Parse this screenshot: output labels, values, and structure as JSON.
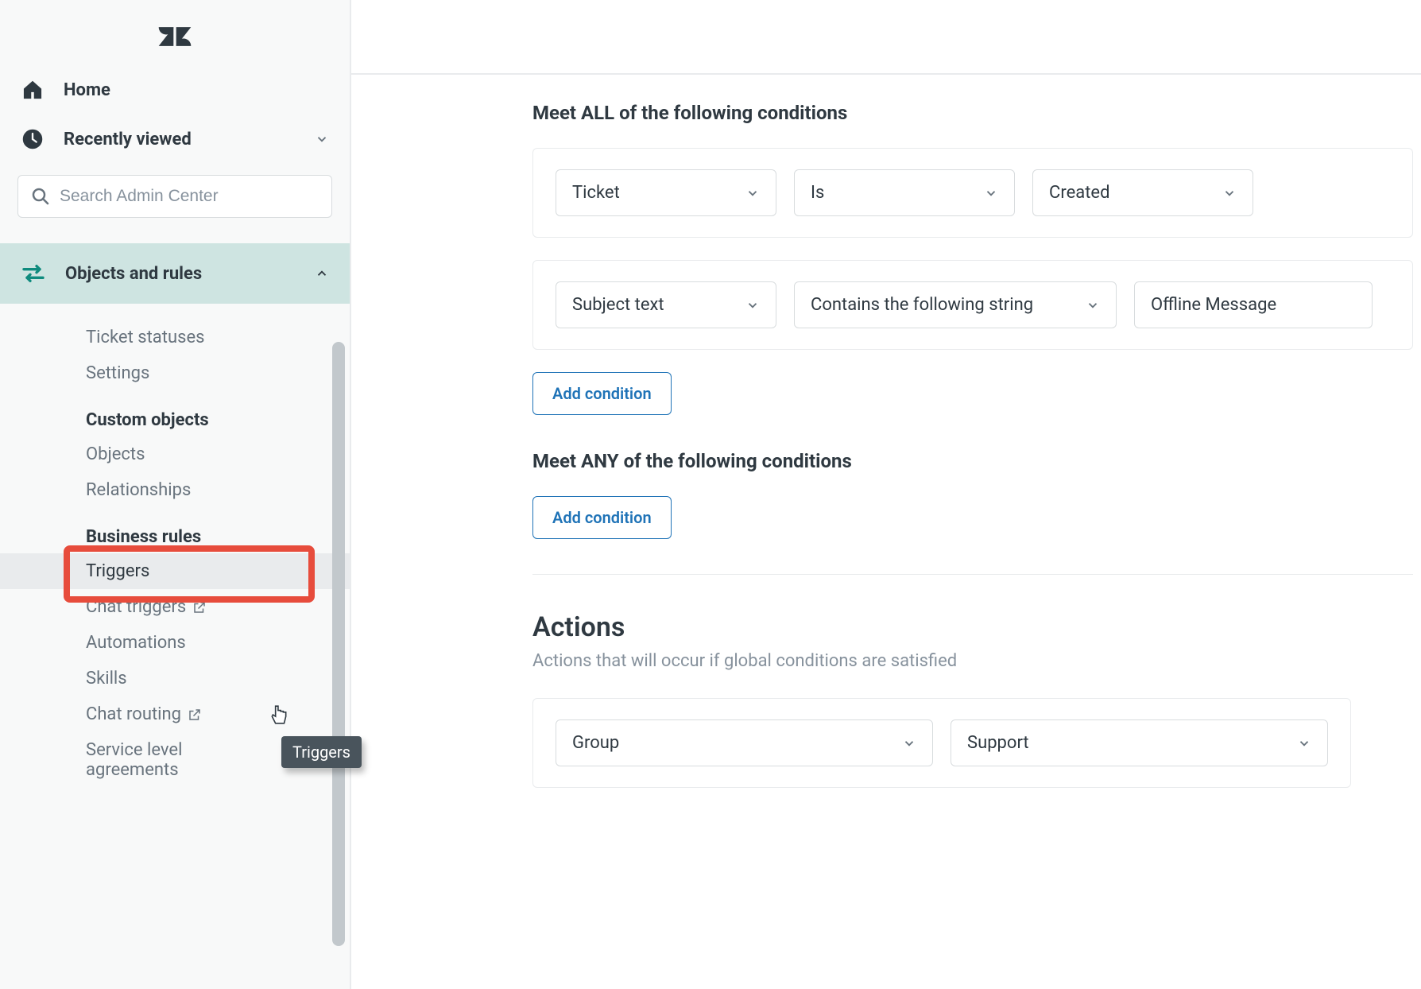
{
  "sidebar": {
    "home": "Home",
    "recently_viewed": "Recently viewed",
    "search_placeholder": "Search Admin Center",
    "section_label": "Objects and rules",
    "items": {
      "ticket_statuses": "Ticket statuses",
      "settings": "Settings",
      "custom_objects_header": "Custom objects",
      "objects": "Objects",
      "relationships": "Relationships",
      "business_rules_header": "Business rules",
      "triggers": "Triggers",
      "chat_triggers": "Chat triggers",
      "automations": "Automations",
      "skills": "Skills",
      "chat_routing": "Chat routing",
      "sla": "Service level agreements"
    },
    "tooltip": "Triggers"
  },
  "main": {
    "all_title": "Meet ALL of the following conditions",
    "any_title": "Meet ANY of the following conditions",
    "add_condition": "Add condition",
    "cond_all": [
      {
        "field": "Ticket",
        "op": "Is",
        "value": "Created"
      },
      {
        "field": "Subject text",
        "op": "Contains the following string",
        "text": "Offline Message"
      }
    ],
    "actions_heading": "Actions",
    "actions_sub": "Actions that will occur if global conditions are satisfied",
    "actions_row": {
      "field": "Group",
      "value": "Support"
    }
  }
}
